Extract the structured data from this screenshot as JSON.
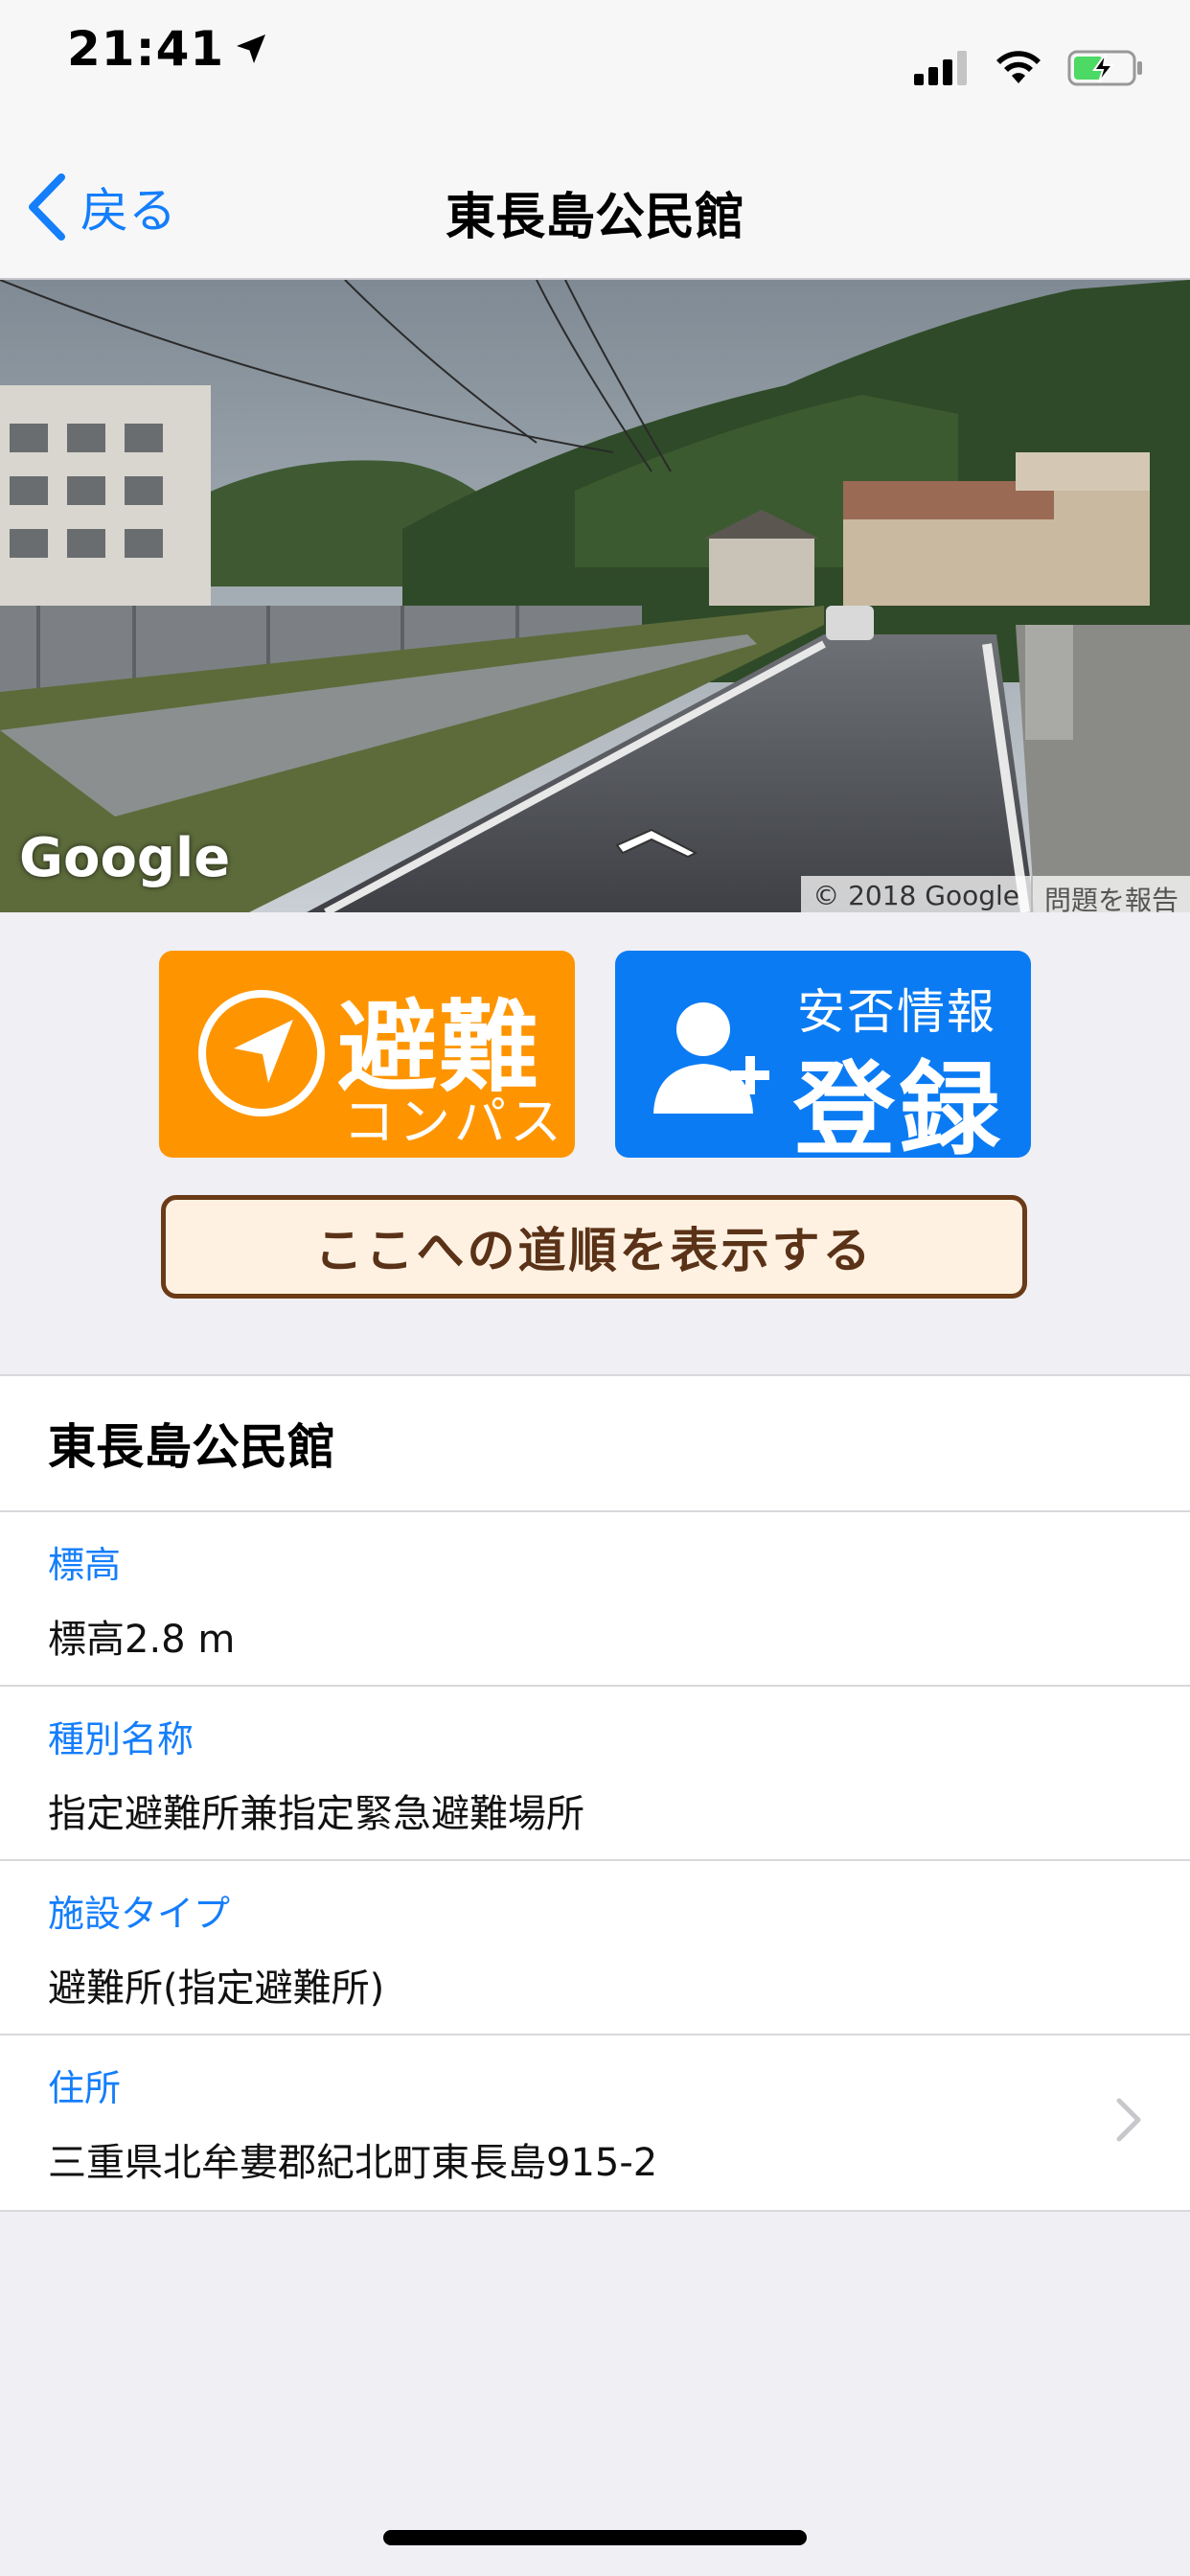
{
  "status_bar": {
    "time": "21:41",
    "icons": [
      "location-arrow-icon",
      "signal-icon",
      "wifi-icon",
      "battery-charging-icon"
    ]
  },
  "nav": {
    "back_label": "戻る",
    "title": "東長島公民館",
    "accent_color": "#147efb"
  },
  "street_view": {
    "logo": "Google",
    "copyright": "© 2018 Google",
    "report_label": "問題を報告"
  },
  "actions": {
    "evacuation_compass": {
      "main": "避難",
      "sub": "コンパス",
      "icon": "compass-arrow-icon",
      "color": "#fe9500"
    },
    "safety_register": {
      "sub": "安否情報",
      "main": "登録",
      "icon": "person-add-icon",
      "color": "#0b7bf3"
    },
    "route_label": "ここへの道順を表示する"
  },
  "details": {
    "title": "東長島公民館",
    "rows": [
      {
        "label": "標高",
        "value": "標高2.8 m"
      },
      {
        "label": "種別名称",
        "value": "指定避難所兼指定緊急避難場所"
      },
      {
        "label": "施設タイプ",
        "value": "避難所(指定避難所)"
      },
      {
        "label": "住所",
        "value": "三重県北牟婁郡紀北町東長島915-2"
      }
    ]
  }
}
